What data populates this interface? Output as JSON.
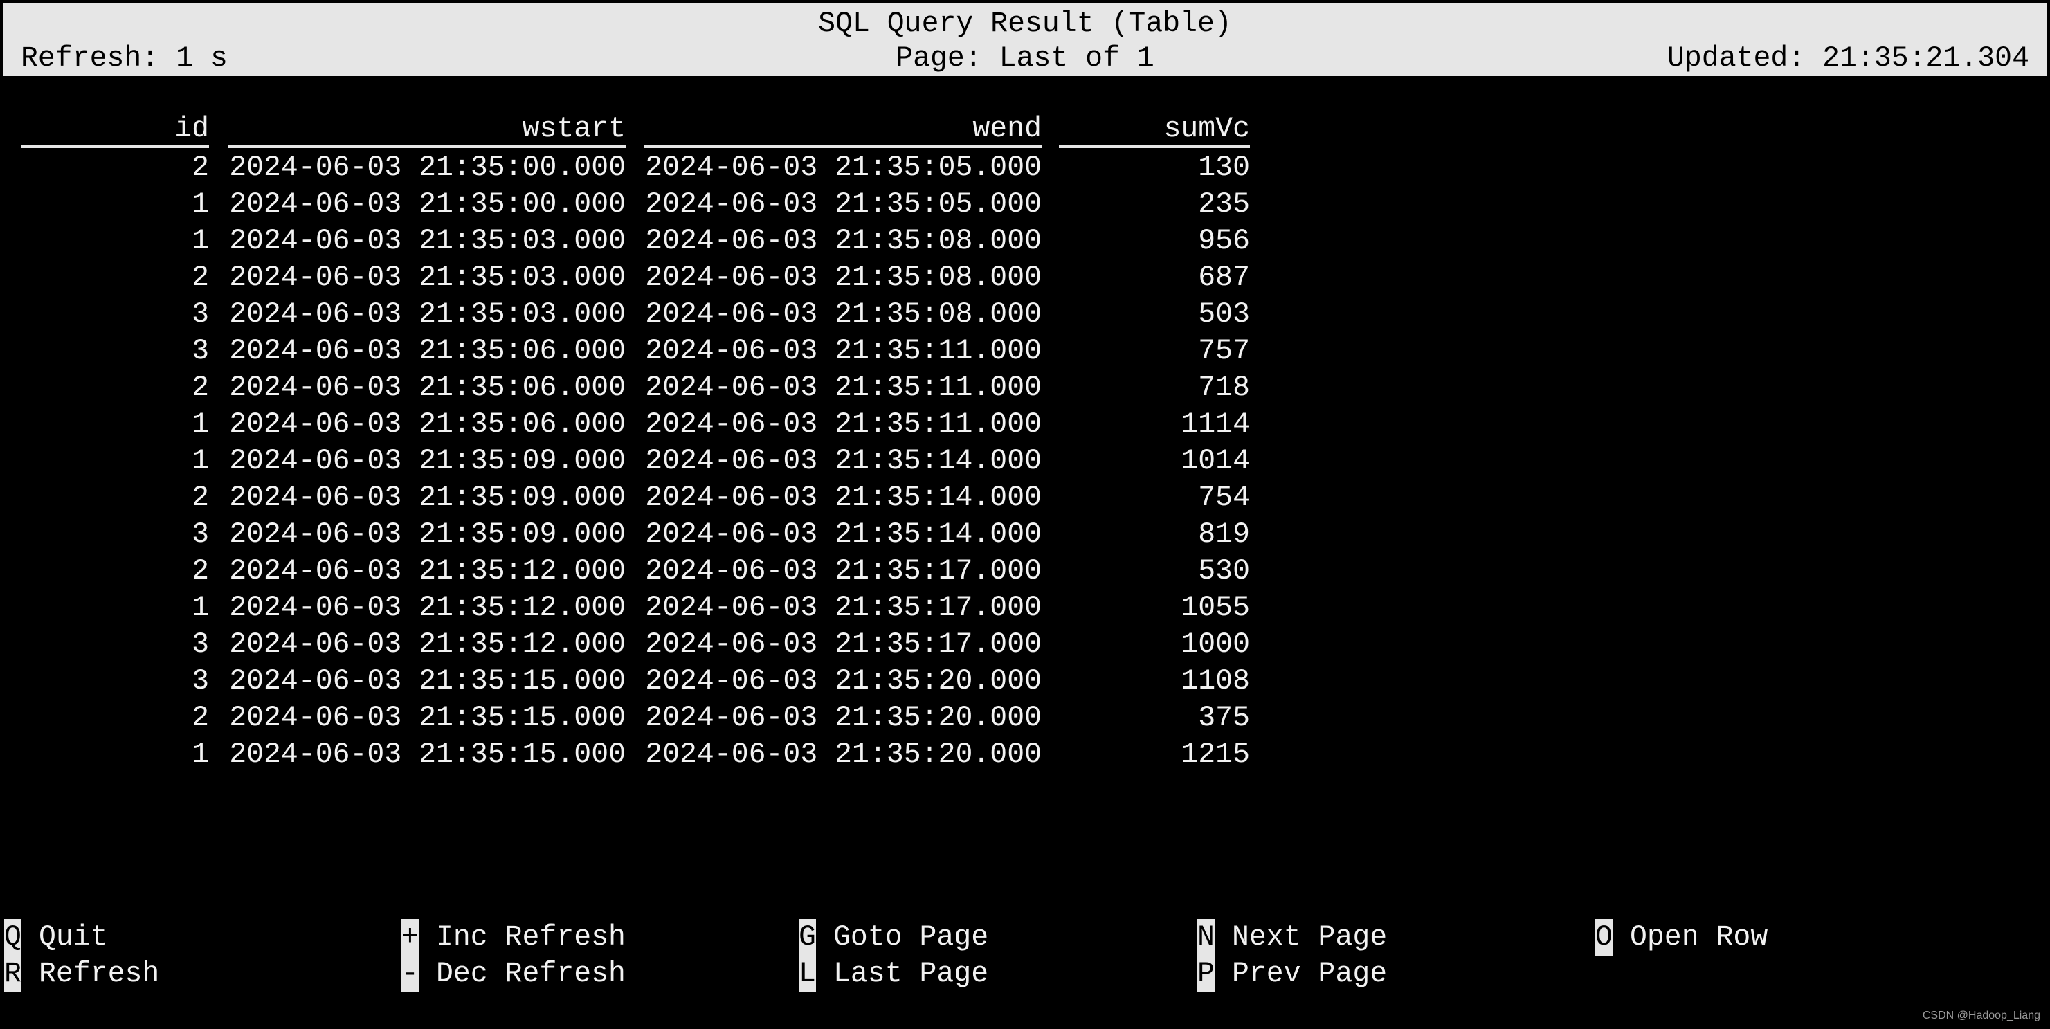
{
  "header": {
    "title": "SQL Query Result (Table)",
    "refresh": "Refresh: 1 s",
    "page": "Page: Last of 1",
    "updated": "Updated: 21:35:21.304"
  },
  "table": {
    "columns": [
      "id",
      "wstart",
      "wend",
      "sumVc"
    ],
    "rows": [
      [
        "2",
        "2024-06-03 21:35:00.000",
        "2024-06-03 21:35:05.000",
        "130"
      ],
      [
        "1",
        "2024-06-03 21:35:00.000",
        "2024-06-03 21:35:05.000",
        "235"
      ],
      [
        "1",
        "2024-06-03 21:35:03.000",
        "2024-06-03 21:35:08.000",
        "956"
      ],
      [
        "2",
        "2024-06-03 21:35:03.000",
        "2024-06-03 21:35:08.000",
        "687"
      ],
      [
        "3",
        "2024-06-03 21:35:03.000",
        "2024-06-03 21:35:08.000",
        "503"
      ],
      [
        "3",
        "2024-06-03 21:35:06.000",
        "2024-06-03 21:35:11.000",
        "757"
      ],
      [
        "2",
        "2024-06-03 21:35:06.000",
        "2024-06-03 21:35:11.000",
        "718"
      ],
      [
        "1",
        "2024-06-03 21:35:06.000",
        "2024-06-03 21:35:11.000",
        "1114"
      ],
      [
        "1",
        "2024-06-03 21:35:09.000",
        "2024-06-03 21:35:14.000",
        "1014"
      ],
      [
        "2",
        "2024-06-03 21:35:09.000",
        "2024-06-03 21:35:14.000",
        "754"
      ],
      [
        "3",
        "2024-06-03 21:35:09.000",
        "2024-06-03 21:35:14.000",
        "819"
      ],
      [
        "2",
        "2024-06-03 21:35:12.000",
        "2024-06-03 21:35:17.000",
        "530"
      ],
      [
        "1",
        "2024-06-03 21:35:12.000",
        "2024-06-03 21:35:17.000",
        "1055"
      ],
      [
        "3",
        "2024-06-03 21:35:12.000",
        "2024-06-03 21:35:17.000",
        "1000"
      ],
      [
        "3",
        "2024-06-03 21:35:15.000",
        "2024-06-03 21:35:20.000",
        "1108"
      ],
      [
        "2",
        "2024-06-03 21:35:15.000",
        "2024-06-03 21:35:20.000",
        "375"
      ],
      [
        "1",
        "2024-06-03 21:35:15.000",
        "2024-06-03 21:35:20.000",
        "1215"
      ]
    ]
  },
  "footer": {
    "shortcuts": [
      {
        "key": "Q",
        "label": "Quit"
      },
      {
        "key": "R",
        "label": "Refresh"
      },
      {
        "key": "+",
        "label": "Inc Refresh"
      },
      {
        "key": "-",
        "label": "Dec Refresh"
      },
      {
        "key": "G",
        "label": "Goto Page"
      },
      {
        "key": "L",
        "label": "Last Page"
      },
      {
        "key": "N",
        "label": "Next Page"
      },
      {
        "key": "P",
        "label": "Prev Page"
      },
      {
        "key": "O",
        "label": "Open Row"
      }
    ]
  },
  "watermark": "CSDN @Hadoop_Liang"
}
